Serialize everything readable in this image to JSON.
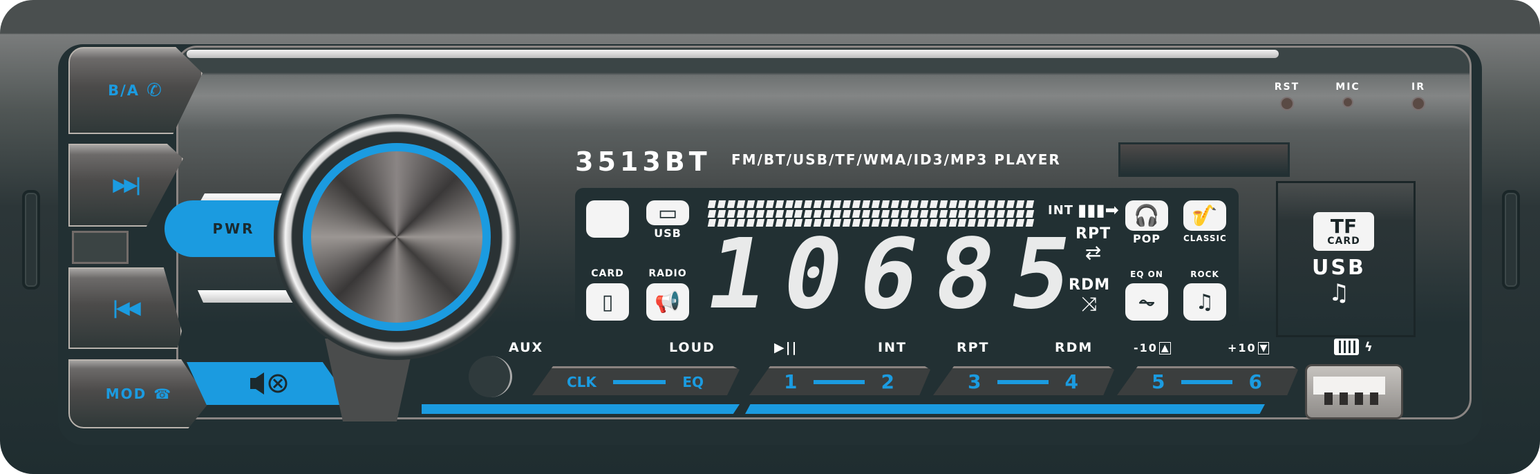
{
  "device": {
    "model": "3513BT",
    "model_subtitle": "FM/BT/USB/TF/WMA/ID3/MP3 PLAYER",
    "accent_color": "#1b9be0",
    "panel_color": "#223033"
  },
  "left_buttons": {
    "ba_label": "B/A",
    "ba_icon": "phone-icon",
    "next_icon_glyph": "▶▶|",
    "prev_icon_glyph": "|◀◀",
    "mod_label": "MOD",
    "mod_icon": "hang-up-icon",
    "pwr_label": "PWR",
    "mute_icon_glyph": "🔇"
  },
  "top_indicators": [
    {
      "label": "RST"
    },
    {
      "label": "MIC"
    },
    {
      "label": "IR"
    }
  ],
  "display": {
    "frequency_digits": [
      "1",
      "0",
      "6",
      "8",
      "5"
    ],
    "frequency_text": "10685",
    "left_icons": [
      {
        "label": "",
        "icon": "blank-tile-icon"
      },
      {
        "label": "USB",
        "icon": "usb-stick-icon"
      },
      {
        "label": "CARD",
        "icon": "sd-card-icon"
      },
      {
        "label": "RADIO",
        "icon": "radio-horn-icon"
      }
    ],
    "mode_indicators": [
      {
        "label": "INT",
        "icon": "arrow-right-icon"
      },
      {
        "label": "RPT",
        "icon": "repeat-icon"
      },
      {
        "label": "RDM",
        "icon": "shuffle-icon"
      }
    ],
    "eq_icons": [
      {
        "label": "POP",
        "icon": "headphones-icon"
      },
      {
        "label": "CLASSIC",
        "icon": "saxophone-icon"
      },
      {
        "label": "EQ ON",
        "icon": "waveform-icon"
      },
      {
        "label": "ROCK",
        "icon": "music-note-icon"
      }
    ]
  },
  "function_labels": {
    "aux": "AUX",
    "loud": "LOUD",
    "play_pause": "▶||",
    "int": "INT",
    "rpt": "RPT",
    "rdm": "RDM",
    "minus10": "-10",
    "plus10": "+10"
  },
  "presets": [
    {
      "left": "CLK",
      "right": "EQ"
    },
    {
      "left": "1",
      "right": "2"
    },
    {
      "left": "3",
      "right": "4"
    },
    {
      "left": "5",
      "right": "6"
    }
  ],
  "card_slot": {
    "tf_line1": "TF",
    "tf_line2": "CARD",
    "usb_label": "USB",
    "note_glyph": "♫"
  },
  "usb_port": {
    "charging_icon": "battery-charging-icon"
  }
}
